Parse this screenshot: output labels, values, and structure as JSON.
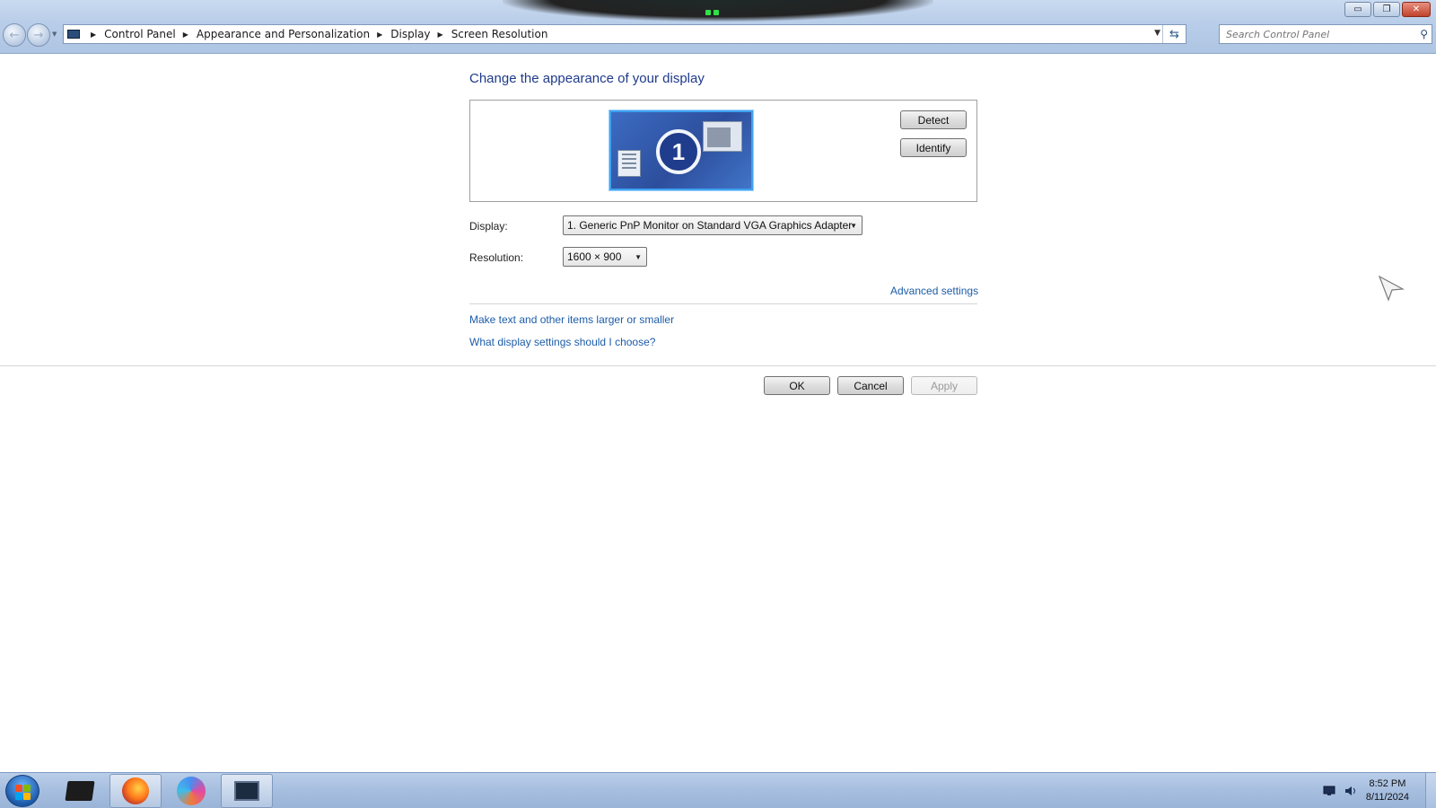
{
  "window": {
    "controls": {
      "minimize": "▭",
      "restore": "❐",
      "close": "✕"
    }
  },
  "nav": {
    "back_glyph": "←",
    "forward_glyph": "→",
    "breadcrumbs": [
      "Control Panel",
      "Appearance and Personalization",
      "Display",
      "Screen Resolution"
    ],
    "search_placeholder": "Search Control Panel"
  },
  "main": {
    "heading": "Change the appearance of your display",
    "monitor_number": "1",
    "detect_label": "Detect",
    "identify_label": "Identify",
    "display_label": "Display:",
    "display_value": "1. Generic PnP Monitor on Standard VGA Graphics Adapter",
    "resolution_label": "Resolution:",
    "resolution_value": "1600 × 900",
    "advanced_link": "Advanced settings",
    "links": [
      "Make text and other items larger or smaller",
      "What display settings should I choose?"
    ],
    "ok_label": "OK",
    "cancel_label": "Cancel",
    "apply_label": "Apply"
  },
  "taskbar": {
    "apps": [
      "file-explorer",
      "firefox",
      "browser",
      "screen-resolution"
    ],
    "time": "8:52 PM",
    "date": "8/11/2024"
  },
  "colors": {
    "link": "#1c5ca8",
    "heading": "#1e3a8a",
    "accent": "#3ea1f0"
  }
}
